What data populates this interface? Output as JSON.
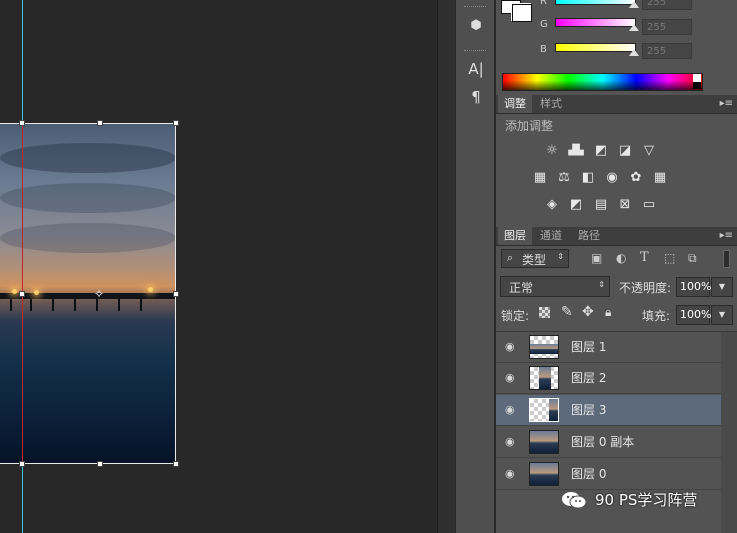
{
  "color_panel": {
    "channels": [
      {
        "label": "R",
        "value": "255"
      },
      {
        "label": "G",
        "value": "255"
      },
      {
        "label": "B",
        "value": "255"
      }
    ]
  },
  "adjust_panel": {
    "tabs": [
      "调整",
      "样式"
    ],
    "title": "添加调整"
  },
  "layers_panel": {
    "tabs": [
      "图层",
      "通道",
      "路径"
    ],
    "filter_label": "类型",
    "blend_mode": "正常",
    "opacity_label": "不透明度:",
    "opacity_value": "100%",
    "lock_label": "锁定:",
    "fill_label": "填充:",
    "fill_value": "100%",
    "layers": [
      {
        "name": "图层 1",
        "selected": false
      },
      {
        "name": "图层 2",
        "selected": false
      },
      {
        "name": "图层 3",
        "selected": true
      },
      {
        "name": "图层 0 副本",
        "selected": false
      },
      {
        "name": "图层 0",
        "selected": false
      }
    ]
  },
  "tools": {
    "character_icon": "A|",
    "paragraph_icon": "¶"
  },
  "watermark": {
    "text": "90 PS学习阵营"
  },
  "colors": {
    "panel_bg": "#535353",
    "selected_layer": "#5d6a7c",
    "guide_cyan": "#37c6d6",
    "guide_red": "#c0262d"
  }
}
